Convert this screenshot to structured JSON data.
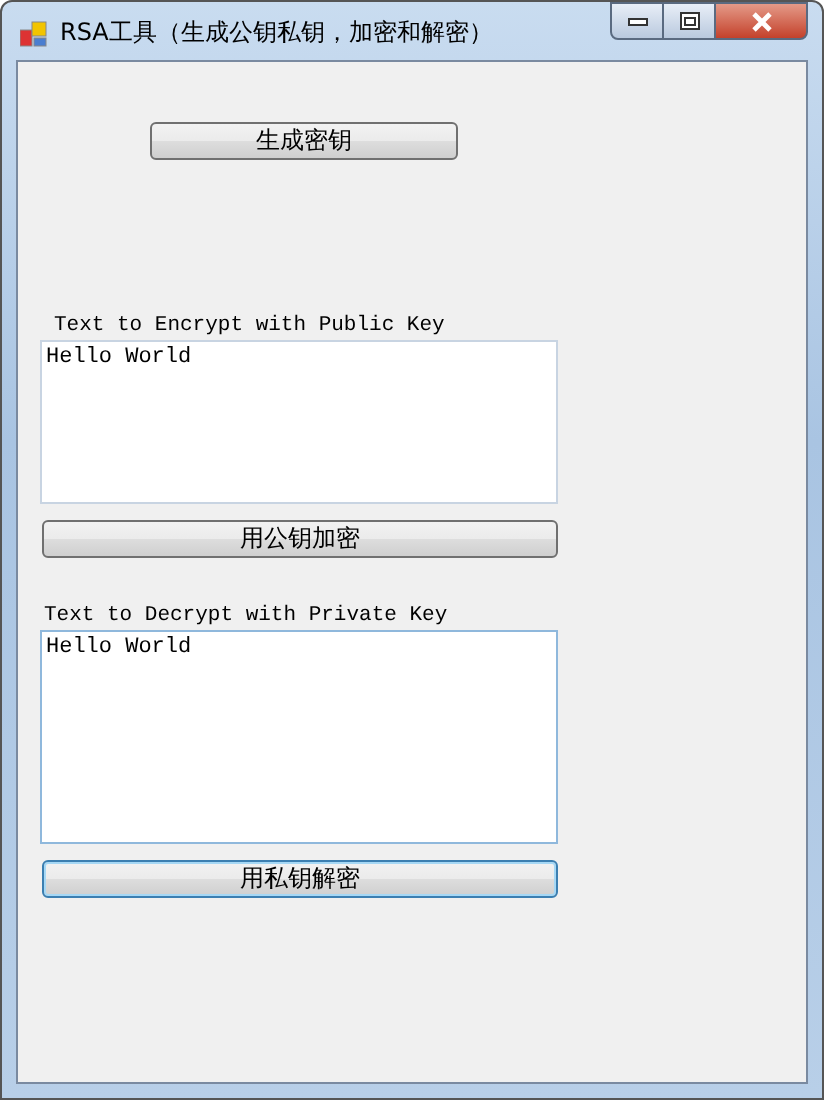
{
  "window": {
    "title": "RSA工具（生成公钥私钥，加密和解密）"
  },
  "generate_button": {
    "label": "生成密钥",
    "focused": false
  },
  "encrypt": {
    "label": "Text to Encrypt with Public Key",
    "text": "Hello World",
    "button": {
      "label": "用公钥加密",
      "focused": false
    }
  },
  "decrypt": {
    "label": "Text to Decrypt with Private Key",
    "text": "Hello World",
    "button": {
      "label": "用私钥解密",
      "focused": true
    }
  }
}
